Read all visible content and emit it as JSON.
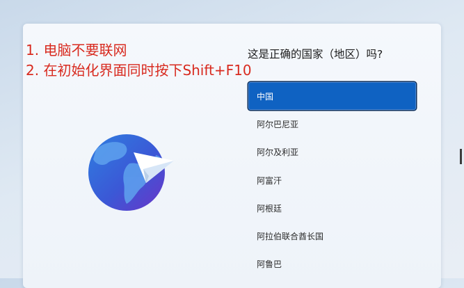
{
  "annotation": {
    "line1": "1. 电脑不要联网",
    "line2": "2. 在初始化界面同时按下Shift+F10"
  },
  "oobe": {
    "question": "这是正确的国家（地区）吗?",
    "countries": [
      {
        "label": "中国",
        "selected": true
      },
      {
        "label": "阿尔巴尼亚",
        "selected": false
      },
      {
        "label": "阿尔及利亚",
        "selected": false
      },
      {
        "label": "阿富汗",
        "selected": false
      },
      {
        "label": "阿根廷",
        "selected": false
      },
      {
        "label": "阿拉伯联合酋长国",
        "selected": false
      },
      {
        "label": "阿鲁巴",
        "selected": false
      }
    ]
  },
  "icons": {
    "globe": "globe-with-paper-plane-icon"
  },
  "colors": {
    "accent": "#0f62c2",
    "annotation_red": "#d82a1f"
  }
}
